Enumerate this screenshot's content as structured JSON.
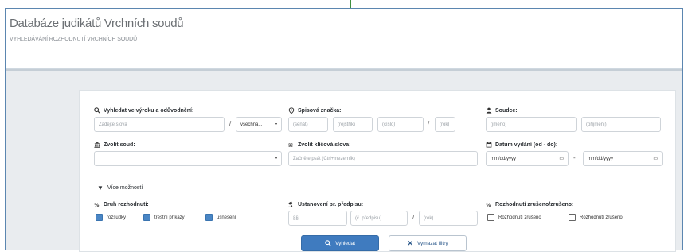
{
  "header": {
    "title": "Databáze judikátů Vrchních soudů",
    "subtitle": "VYHLEDÁVÁNÍ ROZHODNUTÍ VRCHNÍCH SOUDŮ"
  },
  "form": {
    "fulltext": {
      "label": "Vyhledat ve výroku a odůvodnění:",
      "placeholder": "Zadejte slova",
      "mode_value": "všechna..."
    },
    "case_number": {
      "label": "Spisová značka:",
      "parts": [
        "(senát)",
        "(rejstřík)",
        "(číslo)",
        "(rok)"
      ]
    },
    "court": {
      "label": "Soudce:",
      "parts": [
        "(jméno)",
        "(příjmení)"
      ]
    },
    "select_court": {
      "label": "Zvolit soud:",
      "value": ""
    },
    "keyword": {
      "label": "Zvolit klíčová slova:",
      "placeholder": "Začněte psát (Ctrl+mezerník)"
    },
    "date": {
      "label": "Datum vydání (od - do):",
      "from": "mm/dd/yyyy",
      "to": "mm/dd/yyyy",
      "separator": "-"
    },
    "more_options": "Více možností",
    "decision_type": {
      "label": "Druh rozhodnutí:",
      "options": [
        {
          "label": "rozsudky",
          "checked": true
        },
        {
          "label": "trestní příkazy",
          "checked": true
        },
        {
          "label": "usnesení",
          "checked": true
        }
      ]
    },
    "regulation": {
      "label": "Ustanovení pr. předpisu:",
      "parts": [
        "§§",
        "(č. předpisu)",
        "(rok)"
      ]
    },
    "composition": {
      "label": "Rozhodnutí zrušeno/zrušeno:",
      "options": [
        {
          "label": "Rozhodnutí zrušeno",
          "checked": false
        },
        {
          "label": "Rozhodnutí zrušeno",
          "checked": false
        }
      ]
    },
    "buttons": {
      "search": "Vyhledat",
      "clear": "Vymazat filtry"
    }
  },
  "colors": {
    "primary": "#3f7bbf",
    "checkbox_on": "#4a86c5",
    "frame_border": "#5b86b0"
  }
}
